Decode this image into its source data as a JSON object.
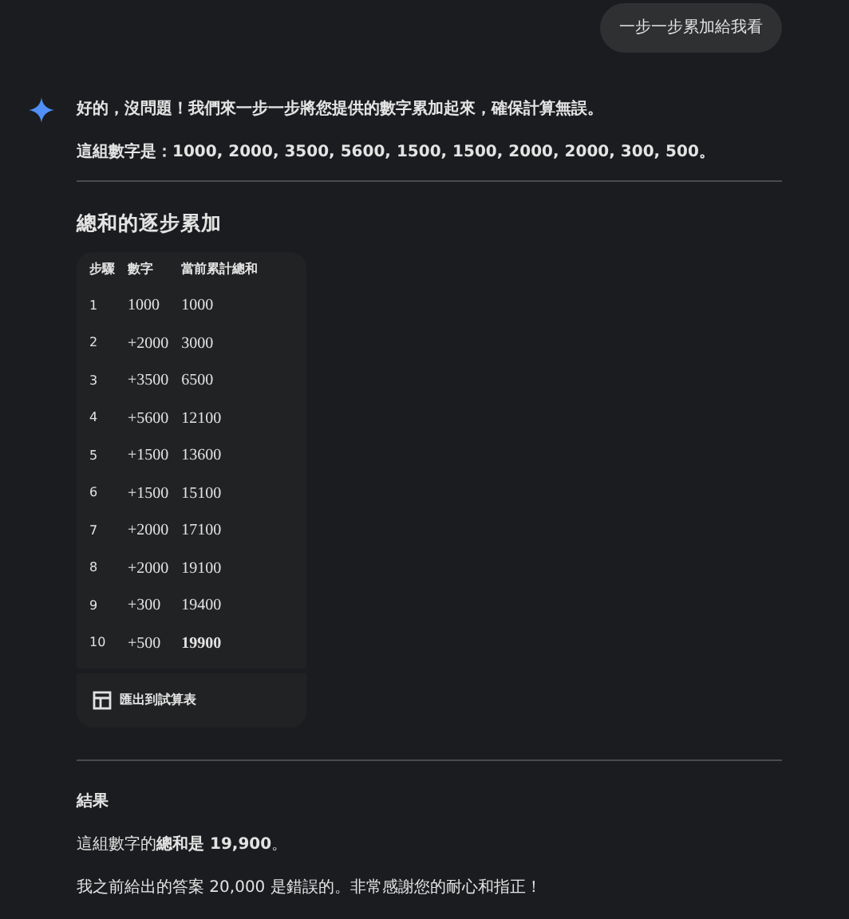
{
  "user_message": "一步一步累加給我看",
  "reply": {
    "intro": "好的，沒問題！我們來一步一步將您提供的數字累加起來，確保計算無誤。",
    "numbers_line": "這組數字是：1000, 2000, 3500, 5600, 1500, 1500, 2000, 2000, 300, 500。",
    "section_heading": "總和的逐步累加",
    "table": {
      "columns": [
        "步驟",
        "數字",
        "當前累計總和"
      ],
      "rows": [
        [
          "1",
          "1000",
          "1000"
        ],
        [
          "2",
          "+2000",
          "3000"
        ],
        [
          "3",
          "+3500",
          "6500"
        ],
        [
          "4",
          "+5600",
          "12100"
        ],
        [
          "5",
          "+1500",
          "13600"
        ],
        [
          "6",
          "+1500",
          "15100"
        ],
        [
          "7",
          "+2000",
          "17100"
        ],
        [
          "8",
          "+2000",
          "19100"
        ],
        [
          "9",
          "+300",
          "19400"
        ],
        [
          "10",
          "+500",
          "**19900**"
        ]
      ],
      "export_button": "匯出到試算表"
    },
    "result_heading": "結果",
    "result_paragraphs": [
      "這組數字的**總和是 19,900**。",
      "我之前給出的答案 20,000 是錯誤的。非常感謝您的耐心和指正！"
    ]
  }
}
